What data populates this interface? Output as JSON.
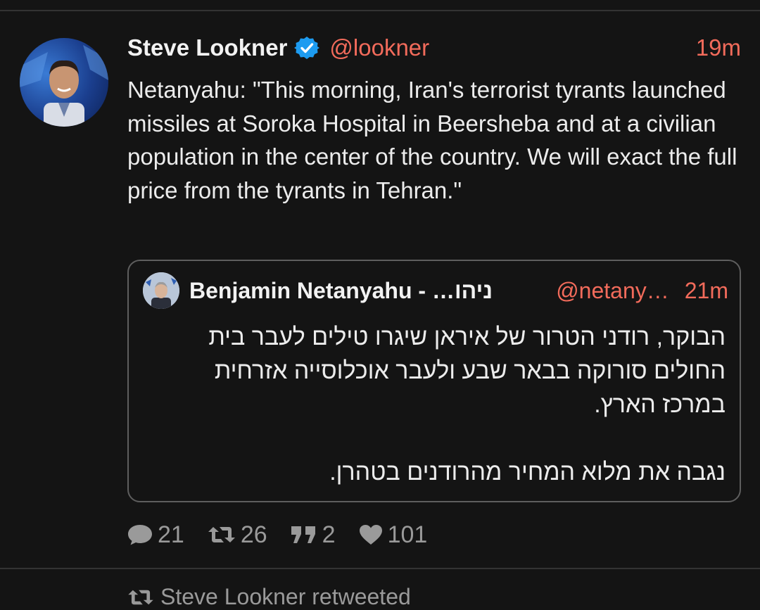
{
  "tweet": {
    "author": {
      "name": "Steve Lookner",
      "handle": "@lookner",
      "verified_icon": "verified-badge-icon"
    },
    "time": "19m",
    "text": "Netanyahu: \"This morning, Iran's terrorist tyrants launched missiles at Soroka Hospital in Beersheba and at a civilian population in the center of the country. We will exact the full price from the tyrants in Tehran.\"",
    "quote": {
      "name": "Benjamin Netanyahu - נתניהו",
      "handle": "@netanyahu",
      "time": "21m",
      "paragraphs": [
        "הבוקר, רודני הטרור של איראן שיגרו טילים לעבר בית החולים סורוקה בבאר שבע ולעבר אוכלוסייה אזרחית במרכז הארץ.",
        "נגבה את מלוא המחיר מהרודנים בטהרן."
      ]
    },
    "actions": {
      "replies": "21",
      "retweets": "26",
      "quotes": "2",
      "likes": "101"
    }
  },
  "next_item": {
    "retweeted_by": "Steve Lookner retweeted"
  },
  "colors": {
    "background": "#141414",
    "accent": "#f26b5b",
    "verified": "#1d9bf0",
    "muted": "#9a9a9a"
  }
}
